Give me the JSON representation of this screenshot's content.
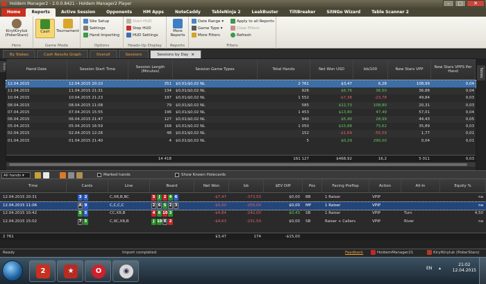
{
  "window": {
    "title": "Holdem Manager2 - 2.0.0.8421 - Holdem Manager2 Player",
    "controls": [
      "–",
      "□",
      "✕"
    ]
  },
  "menu": {
    "tabs": [
      "Home",
      "Reports",
      "Active Session",
      "Opponents",
      "HM Apps",
      "NoteCaddy",
      "TableNinja 2",
      "LeakBuster",
      "TiltBreaker",
      "SitNGo Wizard",
      "Table Scanner 2"
    ],
    "active": "Reports"
  },
  "ribbon": {
    "hero": {
      "name_line1": "KiryIKiryIuk",
      "name_line2": "(PokerStars)",
      "label": "Hero"
    },
    "game_mode": {
      "cash": "Cash",
      "tournament": "Tournament",
      "label": "Game Mode"
    },
    "options": {
      "site_setup": "Site Setup",
      "settings": "Settings",
      "hand_importing": "Hand Importing",
      "label": "Options"
    },
    "hud": {
      "start_hud": "Start HUD",
      "stop_hud": "Stop HUD",
      "hud_settings": "HUD Settings",
      "label": "Heads-Up Display"
    },
    "reports": {
      "more_reports_line1": "More",
      "more_reports_line2": "Reports",
      "label": "Reports"
    },
    "filters": {
      "date_range": "Date Range",
      "game_type": "Game Type",
      "more_filters": "More Filters",
      "apply_all": "Apply to all Reports",
      "clear_filters": "Clear Filters",
      "refresh": "Refresh",
      "label": "Filters"
    }
  },
  "section_tabs": [
    "By Stakes",
    "Cash Results Graph",
    "Overall",
    "Sessions",
    "Sessions by Day"
  ],
  "section_tabs_active": "Sessions by Day",
  "side": {
    "left_label": "Stats",
    "right_label": "Tables"
  },
  "sessions_grid": {
    "headers": [
      "Hand Date",
      "Session Start Time",
      "Session Length (Minutes)",
      "Session Game Types",
      "Total Hands",
      "Net Won USD",
      "bb/100",
      "New Stars VPP",
      "New Stars VPPS Per Hand"
    ],
    "rows": [
      {
        "date": "12.04.2015",
        "start": "12.04.2015 20:10",
        "length": "351",
        "types": "$0,01/$0,02 NL",
        "hands": "2 761",
        "won": "$3,47",
        "bb": "6,28",
        "vpp": "108,99",
        "vpph": "0,04",
        "sign": "pos"
      },
      {
        "date": "11.04.2015",
        "start": "11.04.2015 21:31",
        "length": "134",
        "types": "$0,01/$0,02 NL",
        "hands": "926",
        "won": "$6,76",
        "bb": "36,50",
        "vpp": "36,88",
        "vpph": "0,04",
        "sign": "pos"
      },
      {
        "date": "10.04.2015",
        "start": "10.04.2015 21:23",
        "length": "197",
        "types": "$0,01/$0,02 NL",
        "hands": "1 552",
        "won": "-$7,38",
        "bb": "-23,78",
        "vpp": "49,84",
        "vpph": "0,03",
        "sign": "neg"
      },
      {
        "date": "08.04.2015",
        "start": "08.04.2015 11:08",
        "length": "79",
        "types": "$0,01/$0,02 NL",
        "hands": "585",
        "won": "$12,73",
        "bb": "108,80",
        "vpp": "20,31",
        "vpph": "0,03",
        "sign": "pos"
      },
      {
        "date": "07.04.2015",
        "start": "07.04.2015 15:55",
        "length": "196",
        "types": "$0,01/$0,02 NL",
        "hands": "1 453",
        "won": "$13,80",
        "bb": "47,49",
        "vpp": "57,01",
        "vpph": "0,04",
        "sign": "pos"
      },
      {
        "date": "06.04.2015",
        "start": "06.04.2015 21:47",
        "length": "127",
        "types": "$0,01/$0,02 NL",
        "hands": "940",
        "won": "$5,40",
        "bb": "28,99",
        "vpp": "44,43",
        "vpph": "0,05",
        "sign": "pos"
      },
      {
        "date": "05.04.2015",
        "start": "05.04.2015 16:59",
        "length": "168",
        "types": "$0,01/$0,02 NL",
        "hands": "1 050",
        "won": "$15,88",
        "bb": "75,62",
        "vpp": "35,89",
        "vpph": "0,03",
        "sign": "pos"
      },
      {
        "date": "02.04.2015",
        "start": "02.04.2015 12:26",
        "length": "48",
        "types": "$0,01/$0,02 NL",
        "hands": "152",
        "won": "-$1,69",
        "bb": "-55,59",
        "vpp": "1,77",
        "vpph": "0,01",
        "sign": "neg"
      },
      {
        "date": "01.04.2015",
        "start": "01.04.2015 21:40",
        "length": "4",
        "types": "$0,01/$0,02 NL",
        "hands": "5",
        "won": "$0,29",
        "bb": "290,00",
        "vpp": "0,04",
        "vpph": "0,01",
        "sign": "pos"
      }
    ],
    "totals": {
      "length": "14 418",
      "hands": "161 127",
      "won": "$468,92",
      "bb": "16,2",
      "vpp": "5 011",
      "vpph": "0,03"
    }
  },
  "filter_bar": {
    "select": "All hands",
    "marked_hands": "Marked hands",
    "show_known": "Show Known Holecards"
  },
  "hands_grid": {
    "headers": [
      "Time",
      "Cards",
      "Line",
      "Board",
      "Net Won",
      "bb",
      "$EV Diff",
      "Pos",
      "Facing Preflop",
      "Action",
      "All-In",
      "Equity %"
    ],
    "rows": [
      {
        "time": "12.04.2015 20:31",
        "cards": [
          {
            "r": "3",
            "s": "d"
          },
          {
            "r": "2",
            "s": "d"
          }
        ],
        "line": "C,XR,B,BC",
        "board": [
          {
            "r": "5",
            "s": "h"
          },
          {
            "r": "J",
            "s": "c"
          },
          {
            "r": "2",
            "s": "h"
          },
          {
            "r": "4",
            "s": "c"
          },
          {
            "r": "6",
            "s": "d"
          }
        ],
        "won": "-$7,47",
        "bb": "-373,50",
        "ev": "$0,00",
        "pos": "BB",
        "facing": "1 Raiser",
        "action": "VPIP",
        "allin": "",
        "equity": "na"
      },
      {
        "time": "12.04.2015 11:06",
        "cards": [
          {
            "r": "A",
            "s": "s"
          },
          {
            "r": "9",
            "s": "d"
          }
        ],
        "line": "C,C,C,C",
        "board": [
          {
            "r": "2",
            "s": "s"
          },
          {
            "r": "6",
            "s": "s"
          },
          {
            "r": "5",
            "s": "c"
          },
          {
            "r": "2",
            "s": "s"
          },
          {
            "r": "3",
            "s": "s"
          }
        ],
        "won": "-$5,00",
        "bb": "-250,00",
        "ev": "$0,00",
        "pos": "MP",
        "facing": "1 Raiser",
        "action": "VPIP",
        "allin": "",
        "equity": "na"
      },
      {
        "time": "12.04.2015 10:42",
        "cards": [
          {
            "r": "5",
            "s": "c"
          },
          {
            "r": "5",
            "s": "d"
          }
        ],
        "line": "CC,XR,B",
        "board": [
          {
            "r": "4",
            "s": "h"
          },
          {
            "r": "6",
            "s": "c"
          },
          {
            "r": "10",
            "s": "h"
          },
          {
            "r": "3",
            "s": "c"
          }
        ],
        "won": "-$4,84",
        "bb": "-242,00",
        "ev": "$0,43",
        "pos": "SB",
        "facing": "1 Raiser",
        "action": "VPIP",
        "allin": "Turn",
        "equity": "4,50"
      },
      {
        "time": "12.04.2015 15:02",
        "cards": [
          {
            "r": "7",
            "s": "s"
          },
          {
            "r": "5",
            "s": "c"
          }
        ],
        "line": "C,XC,XR,B",
        "board": [
          {
            "r": "J",
            "s": "c"
          },
          {
            "r": "10",
            "s": "c"
          },
          {
            "r": "8",
            "s": "s"
          },
          {
            "r": "2",
            "s": "h"
          }
        ],
        "won": "-$4,63",
        "bb": "-231,50",
        "ev": "$0,00",
        "pos": "SB",
        "facing": "Raiser + Callers",
        "action": "VPIP",
        "allin": "River",
        "equity": "na"
      }
    ],
    "totals": {
      "count": "2 761",
      "won": "$3,47",
      "bb": "174",
      "ev": "-$15,00"
    }
  },
  "status": {
    "ready": "Ready",
    "import": "Import completed",
    "feedback": "Feedback",
    "app": "HoldemManager21",
    "user": "KiryIKiryIuk (PokerStars)"
  },
  "taskbar": {
    "lang": "EN",
    "time": "21:02",
    "date": "12.04.2015"
  }
}
